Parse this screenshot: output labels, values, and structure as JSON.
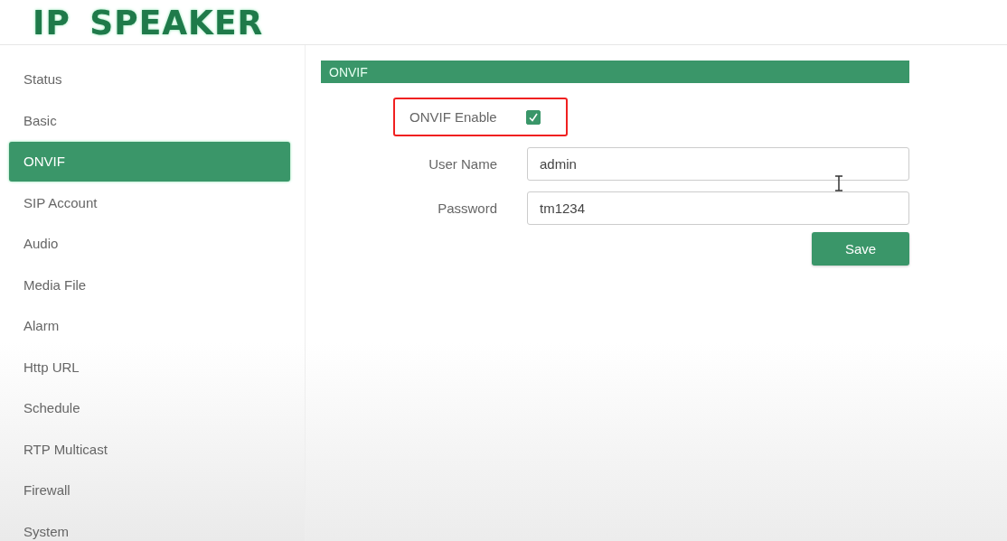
{
  "header": {
    "title": "IP SPEAKER"
  },
  "sidebar": {
    "items": [
      {
        "label": "Status",
        "selected": false
      },
      {
        "label": "Basic",
        "selected": false
      },
      {
        "label": "ONVIF",
        "selected": true
      },
      {
        "label": "SIP Account",
        "selected": false
      },
      {
        "label": "Audio",
        "selected": false
      },
      {
        "label": "Media File",
        "selected": false
      },
      {
        "label": "Alarm",
        "selected": false
      },
      {
        "label": "Http URL",
        "selected": false
      },
      {
        "label": "Schedule",
        "selected": false
      },
      {
        "label": "RTP Multicast",
        "selected": false
      },
      {
        "label": "Firewall",
        "selected": false
      },
      {
        "label": "System",
        "selected": false
      }
    ]
  },
  "panel": {
    "title": "ONVIF",
    "enable": {
      "label": "ONVIF Enable",
      "checked": true,
      "highlighted": true
    },
    "fields": [
      {
        "label": "User Name",
        "value": "admin"
      },
      {
        "label": "Password",
        "value": "tm1234"
      }
    ],
    "save_button": "Save"
  }
}
